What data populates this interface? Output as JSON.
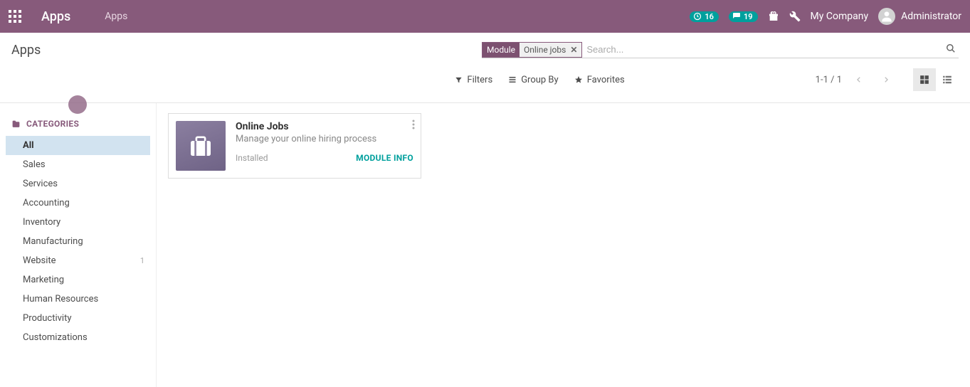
{
  "header": {
    "app_title": "Apps",
    "nav_link": "Apps",
    "activities_count": "16",
    "messages_count": "19",
    "company": "My Company",
    "user": "Administrator"
  },
  "breadcrumb": "Apps",
  "search": {
    "facet_label": "Module",
    "facet_value": "Online jobs",
    "placeholder": "Search..."
  },
  "toolbar": {
    "filters": "Filters",
    "group_by": "Group By",
    "favorites": "Favorites",
    "pager": "1-1 / 1"
  },
  "sidebar": {
    "header": "CATEGORIES",
    "items": [
      {
        "label": "All",
        "active": true
      },
      {
        "label": "Sales"
      },
      {
        "label": "Services"
      },
      {
        "label": "Accounting"
      },
      {
        "label": "Inventory"
      },
      {
        "label": "Manufacturing"
      },
      {
        "label": "Website",
        "count": "1"
      },
      {
        "label": "Marketing"
      },
      {
        "label": "Human Resources"
      },
      {
        "label": "Productivity"
      },
      {
        "label": "Customizations"
      }
    ]
  },
  "card": {
    "title": "Online Jobs",
    "desc": "Manage your online hiring process",
    "status": "Installed",
    "link": "MODULE INFO"
  }
}
